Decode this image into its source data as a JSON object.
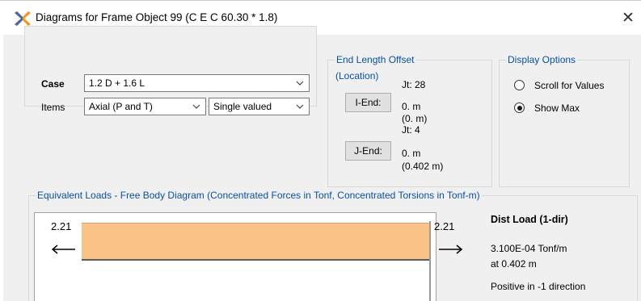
{
  "window": {
    "title": "Diagrams for Frame Object 99  (C E C 60.30 * 1.8)",
    "close_glyph": "✕"
  },
  "case": {
    "case_label": "Case",
    "case_value": "1.2 D + 1.6 L",
    "items_label": "Items",
    "items_value": "Axial (P and T)",
    "valued_value": "Single valued"
  },
  "end_length_offset": {
    "title": "End Length Offset",
    "location_label": "(Location)",
    "i_end_button": "I-End:",
    "i_joint": "Jt:  28",
    "i_offset": "0. m",
    "i_location": "(0. m)",
    "j_end_button": "J-End:",
    "j_joint": "Jt:  4",
    "j_offset": "0. m",
    "j_location": "(0.402 m)"
  },
  "display_options": {
    "title": "Display Options",
    "scroll_label": "Scroll for Values",
    "show_max_label": "Show Max",
    "selected": "Show Max"
  },
  "equivalent_loads": {
    "title": "Equivalent Loads - Free Body Diagram  (Concentrated Forces in Tonf, Concentrated Torsions in Tonf-m)",
    "left_force": "2.21",
    "right_force": "2.21",
    "dist_load_title": "Dist Load (1-dir)",
    "dist_load_value": "3.100E-04 Tonf/m",
    "dist_load_at": "at 0.402 m",
    "dist_load_direction": "Positive in -1 direction"
  },
  "colors": {
    "group_title": "#0a50a1",
    "load_fill": "#fbc287",
    "icon_orange": "#f7941d",
    "icon_blue": "#2b5fb8"
  },
  "icons": [
    "sap2000-app-icon",
    "close-icon",
    "chevron-down-icon",
    "arrow-left-icon",
    "arrow-right-icon"
  ]
}
